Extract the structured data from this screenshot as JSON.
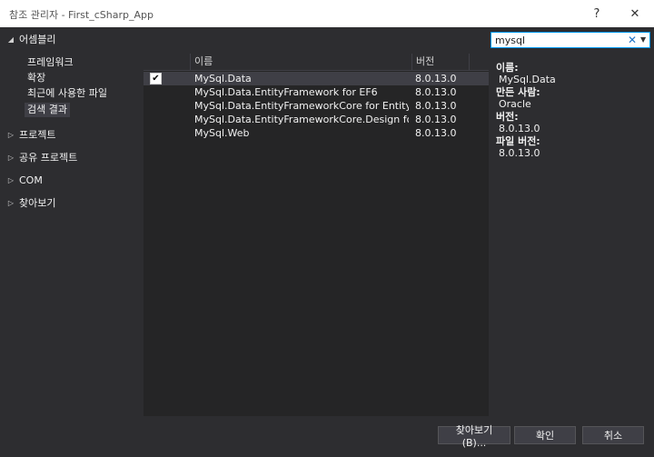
{
  "window": {
    "title": "참조 관리자 - First_cSharp_App",
    "help": "?",
    "close": "✕"
  },
  "tree": {
    "assemblies": {
      "arrow": "◢",
      "label": "어셈블리"
    },
    "sub_items": [
      "프레임워크",
      "확장",
      "최근에 사용한 파일",
      "검색 결과"
    ],
    "nodes": [
      {
        "arrow": "▷",
        "label": "프로젝트"
      },
      {
        "arrow": "▷",
        "label": "공유 프로젝트"
      },
      {
        "arrow": "▷",
        "label": "COM"
      },
      {
        "arrow": "▷",
        "label": "찾아보기"
      }
    ]
  },
  "list": {
    "columns": {
      "name": "이름",
      "version": "버전"
    },
    "rows": [
      {
        "checked": "✔",
        "name": "MySql.Data",
        "version": "8.0.13.0"
      },
      {
        "checked": "",
        "name": "MySql.Data.EntityFramework for EF6",
        "version": "8.0.13.0"
      },
      {
        "checked": "",
        "name": "MySql.Data.EntityFrameworkCore for Entity Fr...",
        "version": "8.0.13.0"
      },
      {
        "checked": "",
        "name": "MySql.Data.EntityFrameworkCore.Design for...",
        "version": "8.0.13.0"
      },
      {
        "checked": "",
        "name": "MySql.Web",
        "version": "8.0.13.0"
      }
    ]
  },
  "search": {
    "value": "mysql",
    "clear": "✕",
    "dropdown": "▼"
  },
  "details": {
    "name_label": "이름:",
    "name_value": "MySql.Data",
    "author_label": "만든 사람:",
    "author_value": "Oracle",
    "version_label": "버전:",
    "version_value": "8.0.13.0",
    "file_version_label": "파일 버전:",
    "file_version_value": "8.0.13.0"
  },
  "buttons": {
    "browse": "찾아보기(B)...",
    "ok": "확인",
    "cancel": "취소"
  }
}
